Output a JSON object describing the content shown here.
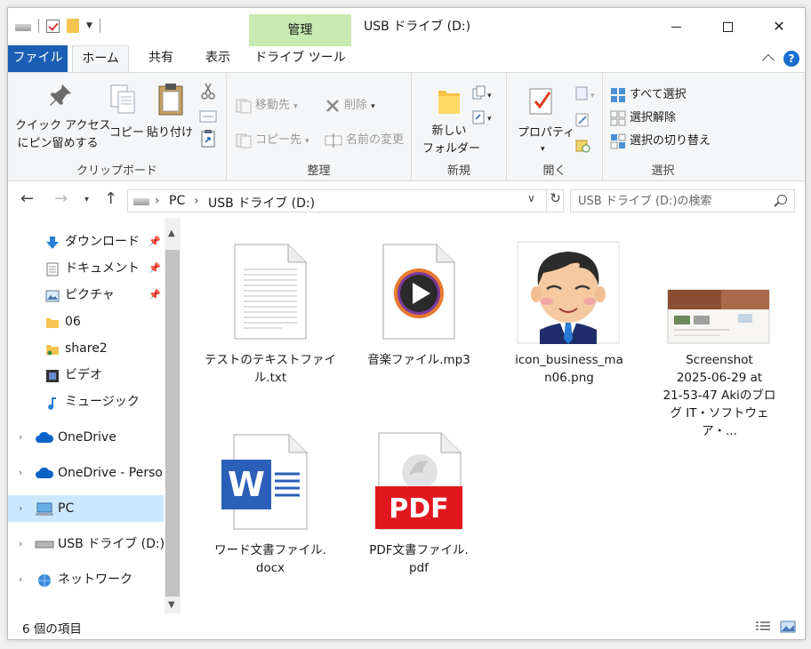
{
  "window": {
    "title": "USB ドライブ (D:)",
    "context_tab_group": "管理"
  },
  "tabs": [
    {
      "label": "ファイル",
      "active": false
    },
    {
      "label": "ホーム",
      "active": true
    },
    {
      "label": "共有",
      "active": false
    },
    {
      "label": "表示",
      "active": false
    },
    {
      "label": "ドライブ ツール",
      "active": false
    }
  ],
  "ribbon": {
    "clipboard": {
      "label": "クリップボード",
      "pin_quick_access": [
        "クイック アクセス",
        "にピン留めする"
      ],
      "copy": "コピー",
      "paste": "貼り付け"
    },
    "organize": {
      "label": "整理",
      "move_to": "移動先",
      "copy_to": "コピー先",
      "delete": "削除",
      "rename": "名前の変更"
    },
    "new": {
      "label": "新規",
      "new_folder": [
        "新しい",
        "フォルダー"
      ]
    },
    "open": {
      "label": "開く",
      "properties": "プロパティ"
    },
    "select": {
      "label": "選択",
      "select_all": "すべて選択",
      "select_none": "選択解除",
      "invert_selection": "選択の切り替え"
    }
  },
  "address": {
    "crumbs": [
      "PC",
      "USB ドライブ (D:)"
    ],
    "search_placeholder": "USB ドライブ (D:)の検索"
  },
  "nav": [
    {
      "label": "ダウンロード",
      "icon": "download-icon",
      "pinned": true
    },
    {
      "label": "ドキュメント",
      "icon": "document-icon",
      "pinned": true
    },
    {
      "label": "ピクチャ",
      "icon": "pictures-icon",
      "pinned": true
    },
    {
      "label": "06",
      "icon": "folder-icon",
      "pinned": false
    },
    {
      "label": "share2",
      "icon": "shared-folder-icon",
      "pinned": false
    },
    {
      "label": "ビデオ",
      "icon": "video-icon",
      "pinned": false
    },
    {
      "label": "ミュージック",
      "icon": "music-icon",
      "pinned": false
    },
    {
      "label": "OneDrive",
      "icon": "cloud-icon",
      "expandable": true
    },
    {
      "label": "OneDrive - Personal",
      "icon": "cloud-icon",
      "expandable": true
    },
    {
      "label": "PC",
      "icon": "pc-icon",
      "expandable": true,
      "selected": true
    },
    {
      "label": "USB ドライブ (D:)",
      "icon": "usb-drive-icon",
      "expandable": true
    },
    {
      "label": "ネットワーク",
      "icon": "network-icon",
      "expandable": true
    }
  ],
  "files": [
    {
      "name_lines": [
        "テストのテキストファイ",
        "ル.txt"
      ],
      "type": "txt"
    },
    {
      "name_lines": [
        "音楽ファイル.mp3"
      ],
      "type": "mp3"
    },
    {
      "name_lines": [
        "icon_business_ma",
        "n06.png"
      ],
      "type": "png"
    },
    {
      "name_lines": [
        "Screenshot",
        "2025-06-29 at",
        "21-53-47 Akiのブロ",
        "グ IT・ソフトウェア・..."
      ],
      "type": "screenshot"
    },
    {
      "name_lines": [
        "ワード文書ファイル.",
        "docx"
      ],
      "type": "docx"
    },
    {
      "name_lines": [
        "PDF文書ファイル.",
        "pdf"
      ],
      "type": "pdf"
    }
  ],
  "status": {
    "item_count": "6 個の項目"
  },
  "icons": {
    "pdf_text": "PDF",
    "word_letter": "W",
    "help": "?"
  },
  "colors": {
    "file_tab": "#1a5fb4",
    "context_tab": "#c6eab0",
    "selection": "#cce8ff",
    "word_blue": "#2b5fb8",
    "pdf_red": "#e2161d"
  }
}
